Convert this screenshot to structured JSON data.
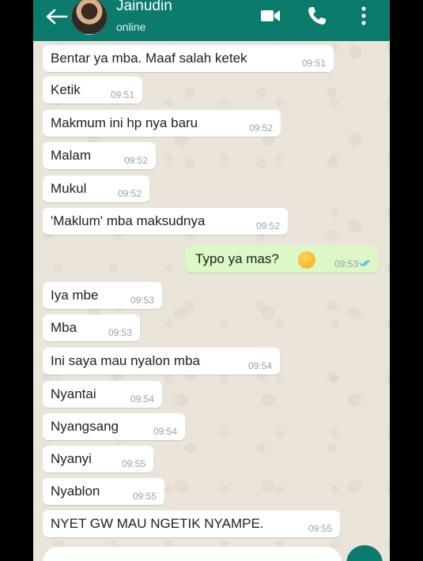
{
  "header": {
    "contact_name": "Jainudin",
    "status": "online",
    "color": "#0a7b6c"
  },
  "messages": [
    {
      "text": "Bentar ya mba. Maaf salah ketek",
      "time": "09:51",
      "dir": "in"
    },
    {
      "text": "Ketik",
      "time": "09:51",
      "dir": "in"
    },
    {
      "text": "Makmum ini hp nya baru",
      "time": "09:52",
      "dir": "in"
    },
    {
      "text": "Malam",
      "time": "09:52",
      "dir": "in"
    },
    {
      "text": "Mukul",
      "time": "09:52",
      "dir": "in"
    },
    {
      "text": "'Maklum' mba maksudnya",
      "time": "09:52",
      "dir": "in"
    },
    {
      "text": "Typo ya mas?",
      "time": "09:53",
      "dir": "out",
      "emoji": "grinning-sweat-emoji",
      "read": true
    },
    {
      "text": "Iya mbe",
      "time": "09:53",
      "dir": "in"
    },
    {
      "text": "Mba",
      "time": "09:53",
      "dir": "in"
    },
    {
      "text": "Ini saya mau nyalon mba",
      "time": "09:54",
      "dir": "in"
    },
    {
      "text": "Nyantai",
      "time": "09:54",
      "dir": "in"
    },
    {
      "text": "Nyangsang",
      "time": "09:54",
      "dir": "in"
    },
    {
      "text": "Nyanyi",
      "time": "09:55",
      "dir": "in"
    },
    {
      "text": "Nyablon",
      "time": "09:55",
      "dir": "in"
    },
    {
      "text": "NYET GW MAU NGETIK NYAMPE.",
      "time": "09:55",
      "dir": "in"
    }
  ],
  "colors": {
    "incoming_bubble": "#ffffff",
    "outgoing_bubble": "#dcf8c6",
    "read_ticks": "#4fb6ec",
    "wallpaper": "#ece5dd"
  }
}
